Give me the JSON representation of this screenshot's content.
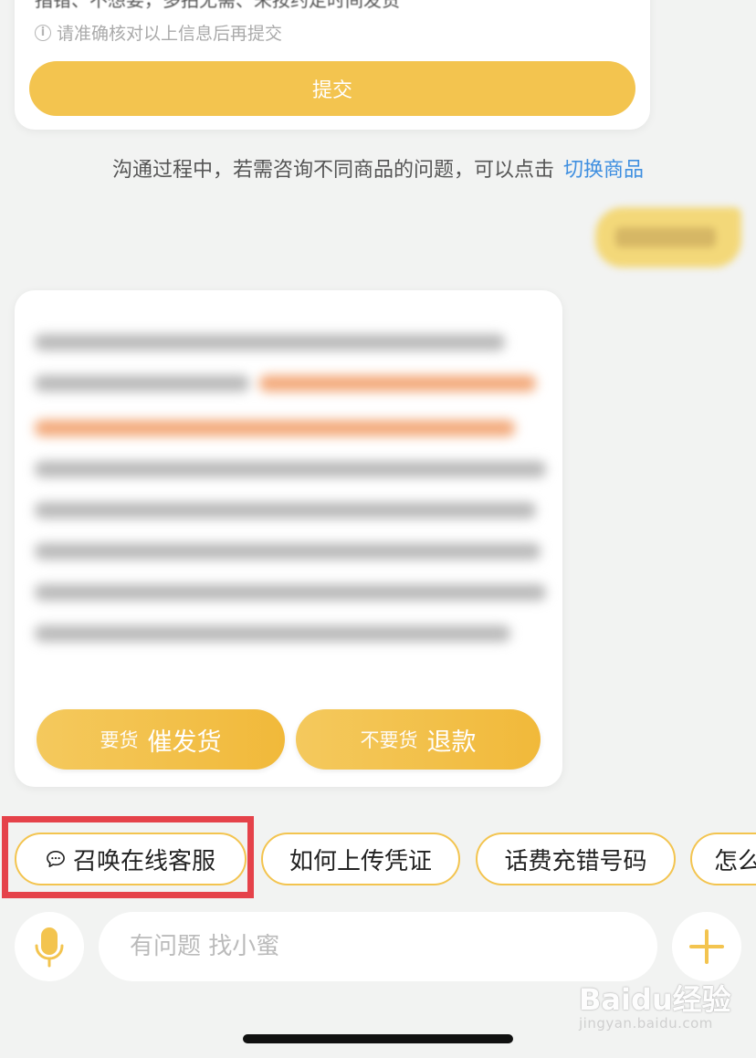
{
  "form": {
    "top_line": "指错、不想要，多拍无需、未按约定时间发货",
    "hint": "请准确核对以上信息后再提交",
    "submit_label": "提交"
  },
  "switch_note": {
    "text": "沟通过程中，若需咨询不同商品的问题，可以点击",
    "link": "切换商品"
  },
  "reply": {
    "urge_small": "要货",
    "urge_big": "催发货",
    "refund_small": "不要货",
    "refund_big": "退款"
  },
  "chips": [
    {
      "label": "召唤在线客服",
      "icon": "chat-bubble-icon"
    },
    {
      "label": "如何上传凭证"
    },
    {
      "label": "话费充错号码"
    },
    {
      "label": "怎么"
    }
  ],
  "input": {
    "placeholder": "有问题 找小蜜"
  },
  "watermark": {
    "brand": "Baidu经验",
    "url": "jingyan.baidu.com"
  },
  "colors": {
    "accent": "#f3c44f",
    "link": "#3f8fe0",
    "highlight": "#e5424a"
  }
}
